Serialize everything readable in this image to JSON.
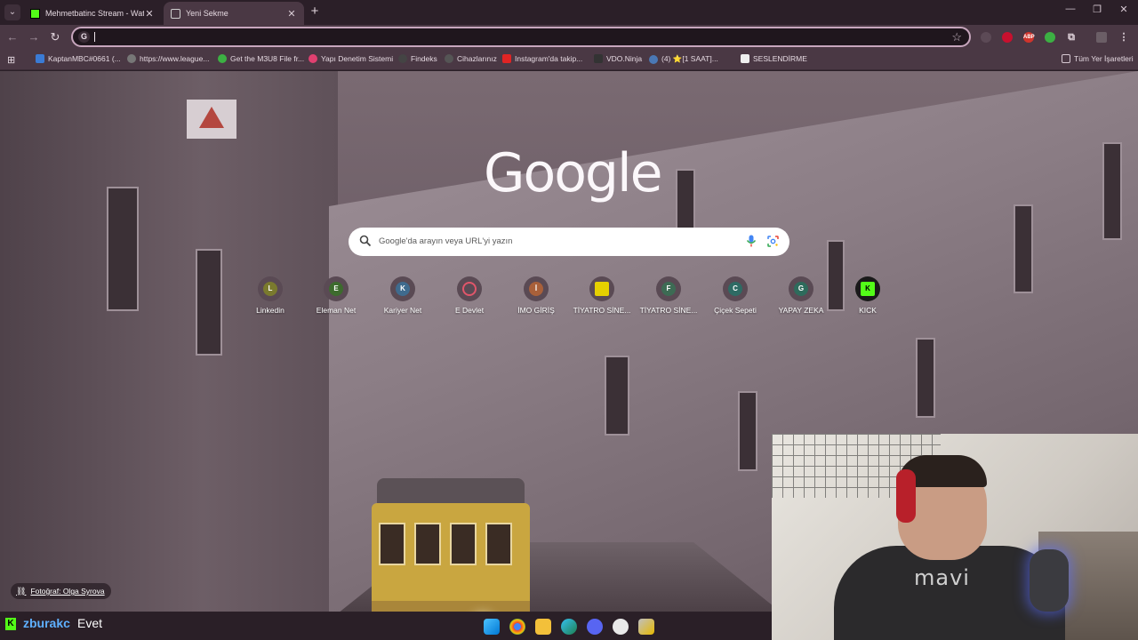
{
  "tabs": [
    {
      "title": "Mehmetbatinc Stream - Watch",
      "favicon": "kick-icon",
      "color": "#53fc18"
    },
    {
      "title": "Yeni Sekme",
      "favicon": "newtab-icon",
      "color": "#cfcfcf"
    }
  ],
  "toolbar": {
    "address_value": "",
    "search_engine_badge": "G"
  },
  "bookmarks": [
    {
      "label": "KaptanMBC#0661 (...",
      "color": "#3a7bd5"
    },
    {
      "label": "https://www.league...",
      "color": "#777777"
    },
    {
      "label": "Get the M3U8 File fr...",
      "color": "#3cb043"
    },
    {
      "label": "Yapı Denetim Sistemi",
      "color": "#e04070"
    },
    {
      "label": "Findeks",
      "color": "#444444"
    },
    {
      "label": "Cihazlarınız",
      "color": "#555555"
    },
    {
      "label": "Instagram'da takip...",
      "color": "#e02424"
    },
    {
      "label": "VDO.Ninja",
      "color": "#333333"
    },
    {
      "label": "(4) ⭐[1 SAAT]...",
      "color": "#4a78b5"
    },
    {
      "label": "SESLENDİRME",
      "color": "#eeeeee"
    }
  ],
  "bookmarks_folder": "Tüm Yer İşaretleri",
  "ntp": {
    "logo": "Google",
    "search_placeholder": "Google'da arayın veya URL'yi yazın",
    "shortcuts": [
      {
        "label": "Linkedin",
        "letter": "L",
        "color": "#7a7a2e"
      },
      {
        "label": "Eleman Net",
        "letter": "E",
        "color": "#3d6b2e"
      },
      {
        "label": "Kariyer Net",
        "letter": "K",
        "color": "#3f6b8e"
      },
      {
        "label": "E Devlet",
        "letter": "",
        "color": "#b23a4e"
      },
      {
        "label": "İMO GİRİŞ",
        "letter": "İ",
        "color": "#a8603a"
      },
      {
        "label": "TİYATRO SİNE...",
        "letter": "",
        "color": "#e6d000"
      },
      {
        "label": "TİYATRO SİNE...",
        "letter": "F",
        "color": "#3d6b54"
      },
      {
        "label": "Çiçek Sepeti",
        "letter": "C",
        "color": "#2e6b64"
      },
      {
        "label": "YAPAY ZEKA",
        "letter": "G",
        "color": "#2e6b5c"
      },
      {
        "label": "KICK",
        "letter": "K",
        "color": "#53fc18"
      }
    ],
    "photo_credit": "Fotoğraf: Olga Syrova"
  },
  "chat": {
    "username": "zburakc",
    "message": "Evet",
    "user_color": "#5fb0ff"
  },
  "webcam_shirt_text": "mavi"
}
